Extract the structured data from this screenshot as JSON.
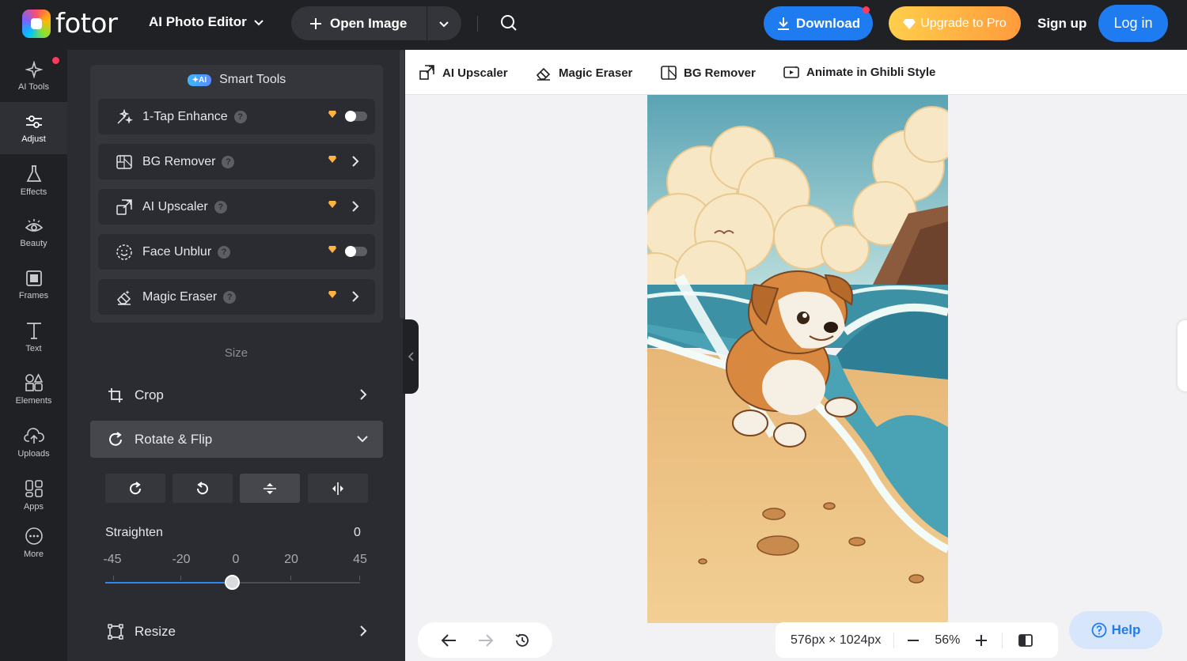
{
  "header": {
    "brand": "fotor",
    "editor_menu": "AI Photo Editor",
    "open_image": "Open Image",
    "download": "Download",
    "upgrade": "Upgrade to Pro",
    "signup": "Sign up",
    "login": "Log in"
  },
  "nav": [
    {
      "label": "AI Tools",
      "icon": "sparkle-icon"
    },
    {
      "label": "Adjust",
      "icon": "sliders-icon"
    },
    {
      "label": "Effects",
      "icon": "flask-icon"
    },
    {
      "label": "Beauty",
      "icon": "eye-icon"
    },
    {
      "label": "Frames",
      "icon": "frame-icon"
    },
    {
      "label": "Text",
      "icon": "text-icon"
    },
    {
      "label": "Elements",
      "icon": "shapes-icon"
    },
    {
      "label": "Uploads",
      "icon": "cloud-upload-icon"
    },
    {
      "label": "Apps",
      "icon": "apps-icon"
    },
    {
      "label": "More",
      "icon": "more-icon"
    }
  ],
  "smart_tools": {
    "badge": "AI",
    "title": "Smart Tools",
    "items": [
      {
        "label": "1-Tap Enhance",
        "control": "toggle",
        "on": false
      },
      {
        "label": "BG Remover",
        "control": "arrow"
      },
      {
        "label": "AI Upscaler",
        "control": "arrow"
      },
      {
        "label": "Face Unblur",
        "control": "toggle",
        "on": false
      },
      {
        "label": "Magic Eraser",
        "control": "arrow"
      }
    ]
  },
  "size_section": {
    "title": "Size",
    "crop": "Crop",
    "rotate_flip": "Rotate & Flip",
    "straighten_label": "Straighten",
    "straighten_value": "0",
    "ticks": [
      "-45",
      "-20",
      "0",
      "20",
      "45"
    ],
    "slider": {
      "min": -45,
      "max": 45,
      "value": 0
    },
    "resize": "Resize"
  },
  "quick_tools": [
    "AI Upscaler",
    "Magic Eraser",
    "BG Remover",
    "Animate in Ghibli Style"
  ],
  "canvas": {
    "dimensions": "576px × 1024px",
    "zoom": "56%"
  },
  "help": "Help",
  "colors": {
    "accent": "#1f7cf0",
    "panel": "#2b2c31",
    "topbar": "#202125",
    "notification": "#ff3b5c"
  }
}
